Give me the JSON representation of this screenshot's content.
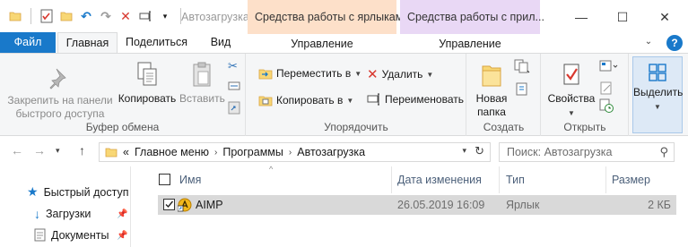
{
  "window": {
    "title": "Автозагрузка",
    "context_tab_shortcut": "Средства работы с ярлыками",
    "context_tab_app": "Средства работы с прил...",
    "minimize": "—",
    "maximize": "☐",
    "close": "✕"
  },
  "ribbon_tabs": {
    "file": "Файл",
    "home": "Главная",
    "share": "Поделиться",
    "view": "Вид",
    "manage1": "Управление",
    "manage2": "Управление",
    "help": "?"
  },
  "ribbon": {
    "clipboard": {
      "label": "Буфер обмена",
      "pin_label": "Закрепить на панели быстрого доступа",
      "pin_line1": "Закрепить на панели",
      "pin_line2": "быстрого доступа",
      "copy": "Копировать",
      "paste": "Вставить"
    },
    "organize": {
      "label": "Упорядочить",
      "move_to": "Переместить в",
      "copy_to": "Копировать в",
      "delete": "Удалить",
      "rename": "Переименовать"
    },
    "new": {
      "label": "Создать",
      "new_folder_line1": "Новая",
      "new_folder_line2": "папка"
    },
    "open": {
      "label": "Открыть",
      "properties": "Свойства"
    },
    "select": {
      "select": "Выделить"
    }
  },
  "address": {
    "overflow": "«",
    "crumbs": [
      "Главное меню",
      "Программы",
      "Автозагрузка"
    ],
    "search_placeholder": "Поиск: Автозагрузка"
  },
  "nav_pane": {
    "items": [
      {
        "label": "Быстрый доступ",
        "icon": "star-icon"
      },
      {
        "label": "Загрузки",
        "icon": "download-icon"
      },
      {
        "label": "Документы",
        "icon": "documents-icon"
      }
    ]
  },
  "file_list": {
    "columns": {
      "name": "Имя",
      "date": "Дата изменения",
      "type": "Тип",
      "size": "Размер"
    },
    "rows": [
      {
        "name": "AIMP",
        "date": "26.05.2019 16:09",
        "type": "Ярлык",
        "size": "2 КБ",
        "selected": true
      }
    ]
  },
  "colors": {
    "accent": "#1979ca",
    "ribbon_bg": "#f5f6f7",
    "context_shortcut": "#fde0c9",
    "context_app": "#e9d8f5",
    "selection": "#d9d9d9"
  }
}
